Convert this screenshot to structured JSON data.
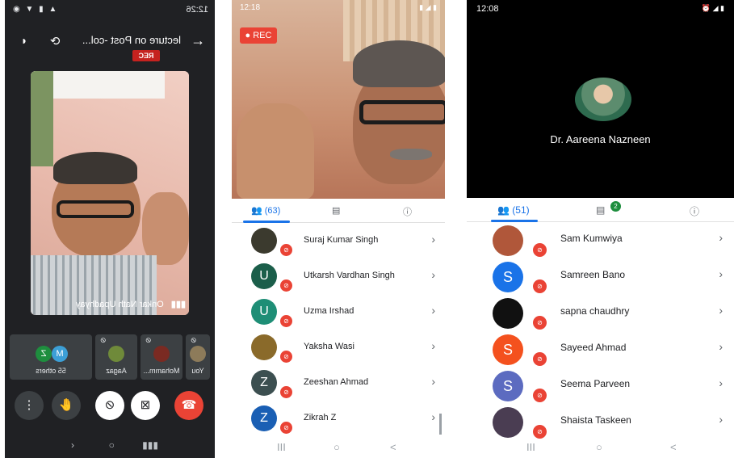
{
  "panel1": {
    "status_time": "12:26",
    "meeting_title": "lecture on Post -col...",
    "rec_badge": "REC",
    "speaker_name": "Onkar Nath Upadhyay",
    "tiles": [
      {
        "label": "You"
      },
      {
        "label": "Mohamm..."
      },
      {
        "label": "Aagaz"
      },
      {
        "label": "55 others",
        "initials": [
          "M",
          "Z"
        ]
      }
    ],
    "nav": [
      "▮▮▮",
      "○",
      "‹"
    ]
  },
  "panel2": {
    "status_time": "12:18",
    "rec_label": "REC",
    "participants_tab": "(63)",
    "participants": [
      {
        "name": "Suraj Kumar Singh",
        "initial": "",
        "color": "#3b3a2e"
      },
      {
        "name": "Utkarsh Vardhan Singh",
        "initial": "U",
        "color": "#1b5e4a"
      },
      {
        "name": "Uzma Irshad",
        "initial": "U",
        "color": "#1e8e76"
      },
      {
        "name": "Yaksha Wasi",
        "initial": "",
        "color": "#8a6a2a"
      },
      {
        "name": "Zeeshan Ahmad",
        "initial": "Z",
        "color": "#3c4f50"
      },
      {
        "name": "Zikrah Z",
        "initial": "Z",
        "color": "#1a5fb4"
      }
    ],
    "nav": [
      "III",
      "○",
      "<"
    ]
  },
  "panel3": {
    "status_time": "12:08",
    "presenter_name": "Dr. Aareena Nazneen",
    "participants_tab": "(51)",
    "chat_badge": "2",
    "participants": [
      {
        "name": "Sam Kumwiya",
        "initial": "",
        "color": "#b0573a"
      },
      {
        "name": "Samreen Bano",
        "initial": "S",
        "color": "#1a73e8"
      },
      {
        "name": "sapna chaudhry",
        "initial": "",
        "color": "#111111"
      },
      {
        "name": "Sayeed Ahmad",
        "initial": "S",
        "color": "#f4511e"
      },
      {
        "name": "Seema Parveen",
        "initial": "S",
        "color": "#5c6bc0"
      },
      {
        "name": "Shaista Taskeen",
        "initial": "",
        "color": "#4a3d52"
      }
    ],
    "nav": [
      "III",
      "○",
      "<"
    ]
  }
}
